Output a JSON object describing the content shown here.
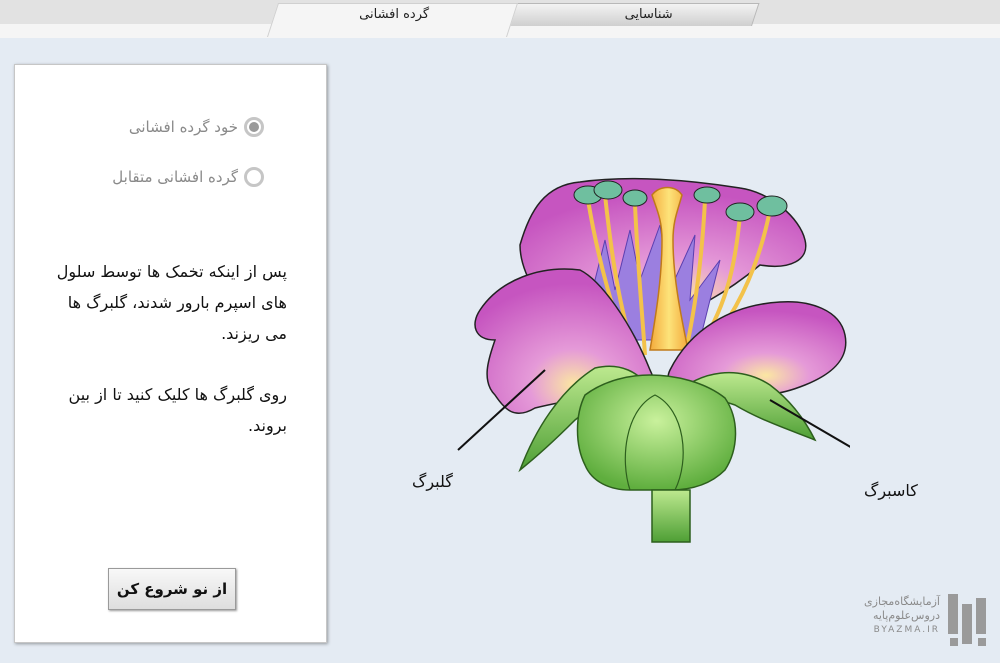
{
  "tabs": [
    {
      "label": "شناسایی",
      "active": false
    },
    {
      "label": "گرده افشانی",
      "active": true
    }
  ],
  "options": [
    {
      "label": "خود گرده افشانی",
      "selected": true
    },
    {
      "label": "گرده افشانی متقابل",
      "selected": false
    }
  ],
  "instructions": {
    "paragraph1": "پس از اینکه تخمک ها توسط سلول های اسپرم بارور شدند، گلبرگ ها می ریزند.",
    "paragraph2": "روی گلبرگ ها کلیک کنید تا از بین بروند."
  },
  "restart_button": "از نو شروع کن",
  "diagram": {
    "label_petal": "گلبرگ",
    "label_sepal": "کاسبرگ"
  },
  "logo": {
    "line1": "آزمایشگاه‌مجازی",
    "line2": "دروس‌علوم‌پایه",
    "line3": "BYAZMA.IR"
  },
  "colors": {
    "petal": "#d96fc9",
    "sepal": "#6ec24a",
    "pistil": "#f5c542",
    "background": "#e4ebf3"
  }
}
